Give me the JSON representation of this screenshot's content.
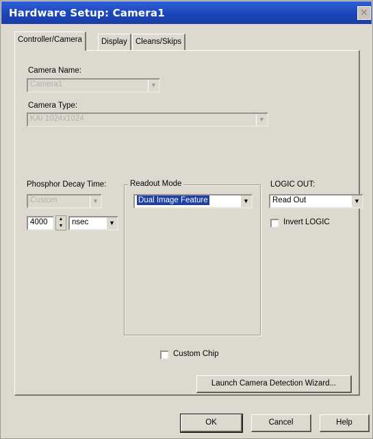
{
  "window": {
    "title": "Hardware Setup: Camera1",
    "close_glyph": "✕"
  },
  "tabs": [
    {
      "label": "Controller/Camera",
      "active": true
    },
    {
      "label": "Display"
    },
    {
      "label": "Cleans/Skips"
    }
  ],
  "camera_name": {
    "label": "Camera Name:",
    "value": "Camera1"
  },
  "camera_type": {
    "label": "Camera Type:",
    "value": "KAI 1024x1024"
  },
  "phosphor": {
    "label": "Phosphor Decay Time:",
    "mode_value": "Custom",
    "time_value": "4000",
    "unit_value": "nsec"
  },
  "readout": {
    "label": "Readout Mode",
    "value": "Dual Image Feature"
  },
  "logic_out": {
    "label": "LOGIC OUT:",
    "value": "Read Out",
    "invert_label": "Invert LOGIC"
  },
  "custom_chip": {
    "label": "Custom Chip"
  },
  "wizard_button": "Launch Camera Detection Wizard...",
  "footer": {
    "ok": "OK",
    "cancel": "Cancel",
    "help": "Help"
  },
  "icons": {
    "dropdown": "dropdown-arrow-icon",
    "spin": "spin-arrows-icon",
    "close": "close-icon"
  }
}
